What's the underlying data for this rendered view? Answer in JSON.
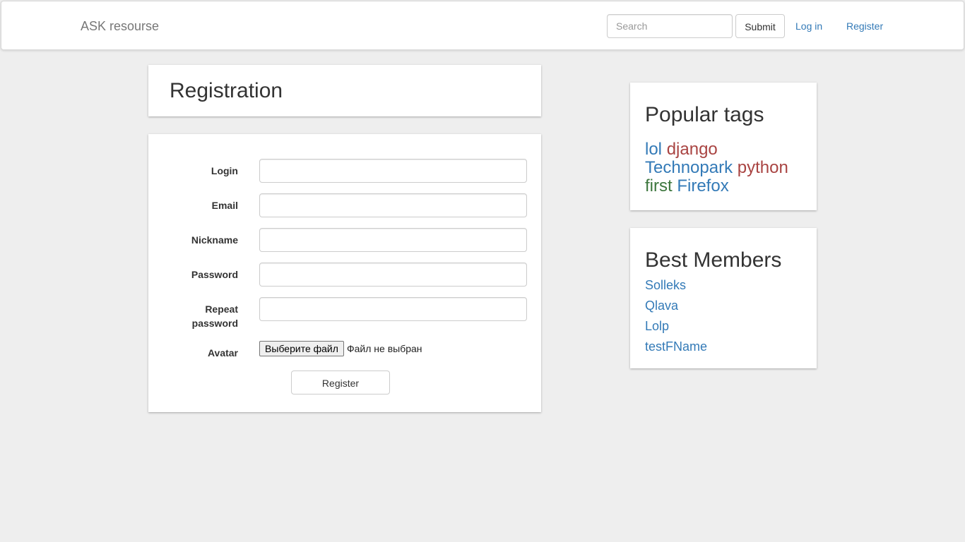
{
  "navbar": {
    "brand": "ASK resourse",
    "search_placeholder": "Search",
    "submit_label": "Submit",
    "login_label": "Log in",
    "register_label": "Register"
  },
  "page": {
    "title": "Registration"
  },
  "form": {
    "fields": [
      {
        "label": "Login",
        "value": ""
      },
      {
        "label": "Email",
        "value": ""
      },
      {
        "label": "Nickname",
        "value": ""
      },
      {
        "label": "Password",
        "value": ""
      },
      {
        "label": "Repeat password",
        "value": ""
      }
    ],
    "avatar_label": "Avatar",
    "file_button_label": "Выберите файл",
    "file_status": "Файл не выбран",
    "submit_label": "Register"
  },
  "sidebar": {
    "tags_title": "Popular tags",
    "tags": [
      {
        "label": "lol",
        "color": "#337ab7"
      },
      {
        "label": "django",
        "color": "#a94442"
      },
      {
        "label": "Technopark",
        "color": "#337ab7"
      },
      {
        "label": "python",
        "color": "#a94442"
      },
      {
        "label": "first",
        "color": "#3c763d"
      },
      {
        "label": "Firefox",
        "color": "#337ab7"
      }
    ],
    "members_title": "Best Members",
    "members": [
      "Solleks",
      "Qlava",
      "Lolp",
      "testFName"
    ]
  },
  "colors": {
    "link": "#337ab7",
    "background": "#eeeeee",
    "panel": "#ffffff"
  }
}
